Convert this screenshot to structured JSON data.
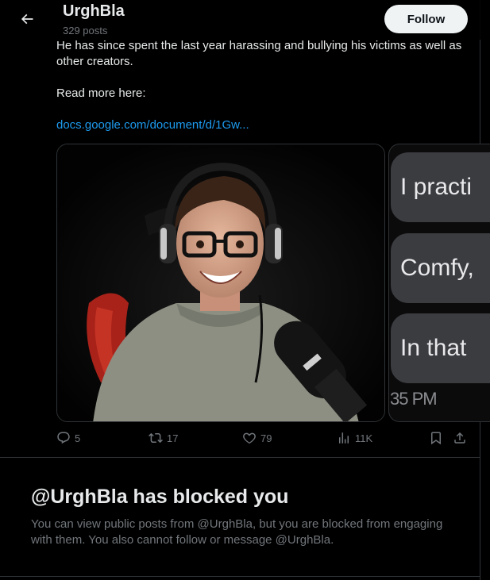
{
  "header": {
    "display_name": "UrghBla",
    "post_count": "329 posts",
    "follow_label": "Follow"
  },
  "tweet": {
    "text_lines": [
      "He has since spent the last year harassing and bullying his victims as well as other creators.",
      "Read more here:"
    ],
    "link_text": "docs.google.com/document/d/1Gw...",
    "media_2": {
      "bubbles": [
        "I practi",
        "Comfy,",
        "In that"
      ],
      "time": "35 PM"
    },
    "actions": {
      "replies": "5",
      "reposts": "17",
      "likes": "79",
      "views": "11K"
    }
  },
  "blocked": {
    "title": "@UrghBla has blocked you",
    "description": "You can view public posts from @UrghBla, but you are blocked from engaging with them. You also cannot follow or message @UrghBla."
  },
  "colors": {
    "background": "#000000",
    "text": "#e7e9ea",
    "muted": "#71767b",
    "link": "#1d9bf0",
    "border": "#2f3336"
  }
}
